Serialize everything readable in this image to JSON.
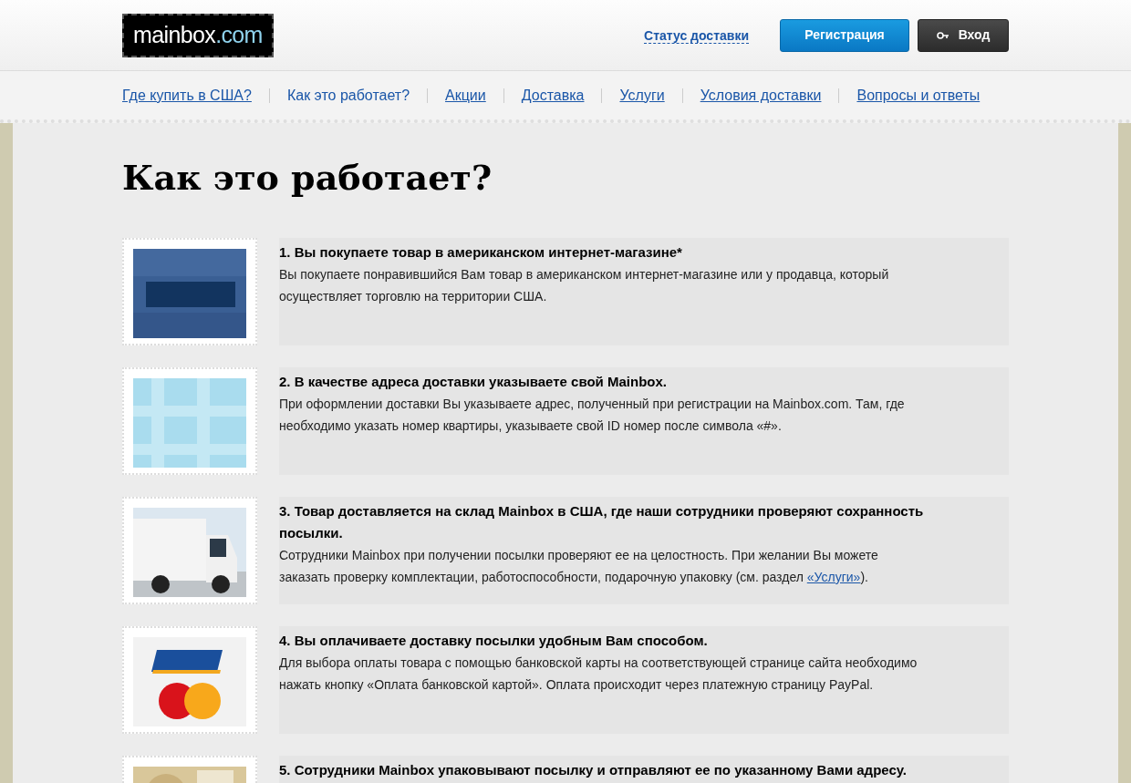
{
  "header": {
    "logo": {
      "name": "mainbox",
      "suffix": ".com"
    },
    "status_link": "Статус доставки",
    "register_button": "Регистрация",
    "login_button": "Вход"
  },
  "nav": [
    {
      "label": "Где купить в США?",
      "selected": false
    },
    {
      "label": "Как это работает?",
      "selected": true
    },
    {
      "label": "Акции",
      "selected": false
    },
    {
      "label": "Доставка",
      "selected": false
    },
    {
      "label": "Услуги",
      "selected": false
    },
    {
      "label": "Условия доставки",
      "selected": false
    },
    {
      "label": "Вопросы и ответы",
      "selected": false
    }
  ],
  "title": "Как это работает?",
  "steps": [
    {
      "kind": "picture",
      "heading": "1. Вы покупаете товар в американском интернет-магазине*",
      "text": "Вы покупаете понравившийся Вам товар в американском интернет-магазине или у продавца, который осуществляет торговлю на территории США."
    },
    {
      "kind": "picture",
      "heading": "2. В качестве адреса доставки указываете свой Mainbox.",
      "text": "При оформлении доставки Вы указываете адрес, полученный при регистрации на Mainbox.com. Там, где необходимо указать номер квартиры, указываете свой ID номер после символа «#»."
    },
    {
      "kind": "picture",
      "heading": "3. Товар доставляется на склад Mainbox в США, где наши сотрудники проверяют сохранность посылки.",
      "text": "Сотрудники Mainbox при получении посылки проверяют ее на целостность. При желании Вы можете заказать проверку комплектации, работоспособности, подарочную упаковку (см. раздел ",
      "link": "«Услуги»",
      "text_after": ")."
    },
    {
      "kind": "picture",
      "heading": "4. Вы оплачиваете доставку посылки удобным Вам способом.",
      "text": "Для выбора оплаты товара с помощью банковской карты на соответствующей странице сайта необходимо нажать кнопку «Оплата банковской картой». Оплата происходит через платежную страницу PayPal."
    },
    {
      "kind": "picture",
      "heading": "5. Сотрудники Mainbox упаковывают посылку и отправляют ее по указанному Вами адресу."
    }
  ]
}
